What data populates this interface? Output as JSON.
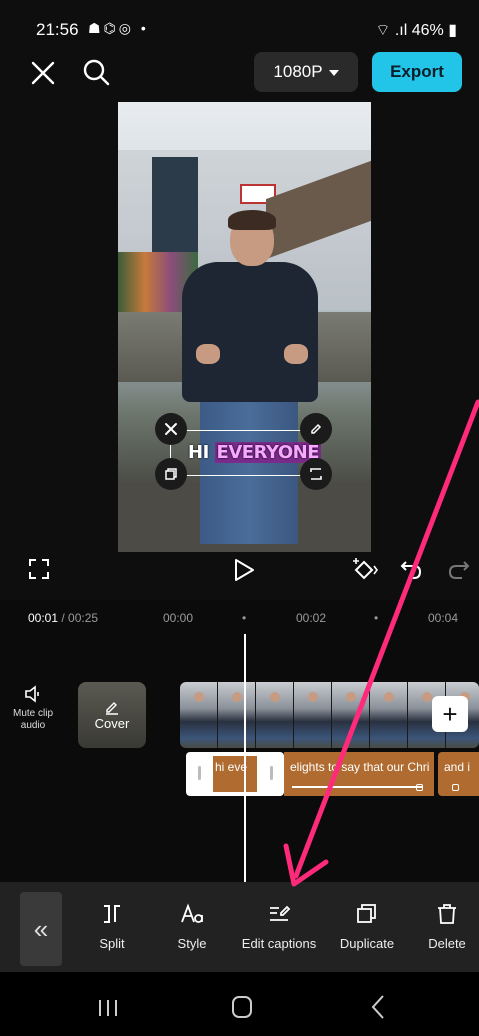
{
  "status_bar": {
    "time": "21:56",
    "app_icons": "☗⌬◎ •",
    "right_text": "46%"
  },
  "top_bar": {
    "resolution": "1080P",
    "export_label": "Export"
  },
  "caption_overlay": {
    "word1": "HI",
    "word2": "EVERYONE"
  },
  "timeline": {
    "current_time": "00:01",
    "total_time": " / 00:25",
    "ticks": [
      "00:00",
      "•",
      "00:02",
      "•",
      "00:04"
    ],
    "mute_label": "Mute clip audio",
    "cover_label": "Cover",
    "selected_caption_text": "hi eve",
    "caption_clips": [
      "elights to say that our Chri",
      "and i"
    ]
  },
  "toolbar": {
    "tools": [
      {
        "icon": "split-icon",
        "label": "Split"
      },
      {
        "icon": "style-icon",
        "label": "Style"
      },
      {
        "icon": "edit-captions-icon",
        "label": "Edit captions"
      },
      {
        "icon": "duplicate-icon",
        "label": "Duplicate"
      },
      {
        "icon": "delete-icon",
        "label": "Delete"
      }
    ]
  },
  "colors": {
    "export": "#22c4e8",
    "caption_clip": "#b06c30",
    "annotation_arrow": "#ff2a7a",
    "caption_highlight": "#f7a8ff"
  }
}
